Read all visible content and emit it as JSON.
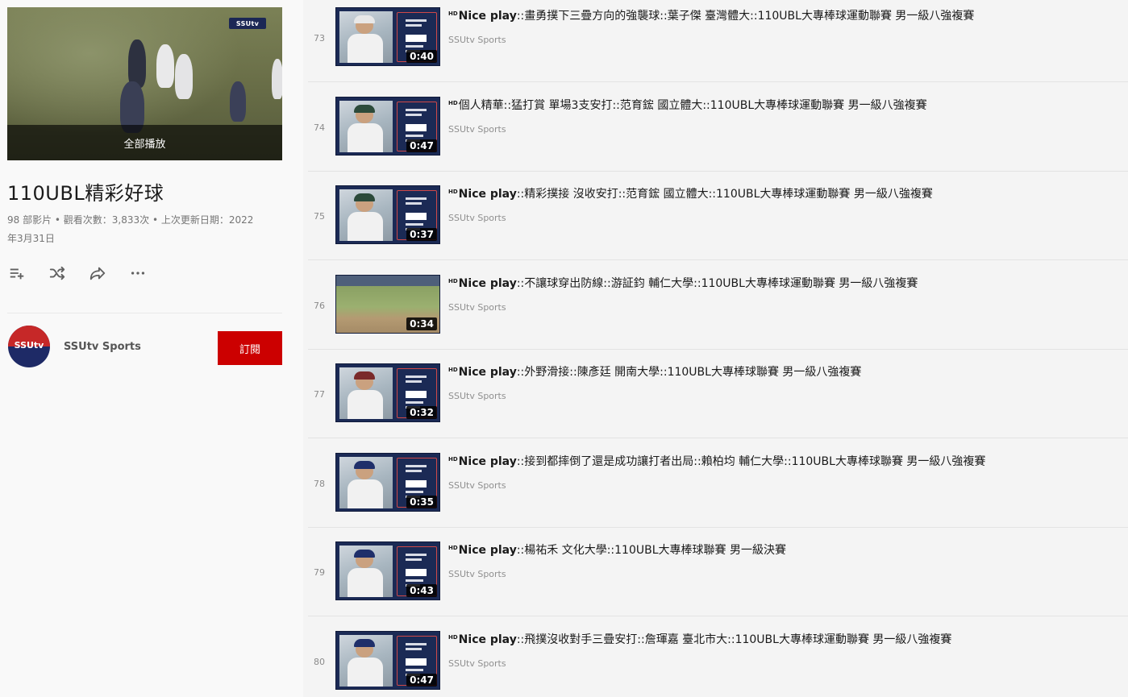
{
  "playlist": {
    "title": "110UBL精彩好球",
    "meta": "98 部影片 • 觀看次數：3,833次 • 上次更新日期：2022年3月31日",
    "play_all": "全部播放",
    "hero_logo": "SSUtv",
    "actions": [
      {
        "icon": "add-to-queue-icon"
      },
      {
        "icon": "shuffle-icon"
      },
      {
        "icon": "share-icon"
      },
      {
        "icon": "more-icon"
      }
    ]
  },
  "channel": {
    "name": "SSUtv Sports",
    "avatar_text": "SSUtv",
    "subscribe_label": "訂閱",
    "subscribe_color": "#cc0000"
  },
  "videos": [
    {
      "index": "73",
      "hd": "HD",
      "lead": "Nice play",
      "title": "::畫勇撲下三疊方向的強襲球::葉子傑 臺灣體大::110UBL大專棒球運動聯賽 男一級八強複賽",
      "channel": "SSUtv Sports",
      "duration": "0:40",
      "cap_color": "#e8e8e8"
    },
    {
      "index": "74",
      "hd": "HD",
      "lead": "",
      "title": "個人精華::猛打賞 單場3支安打::范育鋐 國立體大::110UBL大專棒球運動聯賽 男一級八強複賽",
      "channel": "SSUtv Sports",
      "duration": "0:47",
      "cap_color": "#2c4a3a"
    },
    {
      "index": "75",
      "hd": "HD",
      "lead": "Nice play",
      "title": "::精彩撲接 沒收安打::范育鋐 國立體大::110UBL大專棒球運動聯賽 男一級八強複賽",
      "channel": "SSUtv Sports",
      "duration": "0:37",
      "cap_color": "#2c4a3a"
    },
    {
      "index": "76",
      "hd": "HD",
      "lead": "Nice play",
      "title": "::不讓球穿出防線::游証鈞 輔仁大學::110UBL大專棒球運動聯賽 男一級八強複賽",
      "channel": "SSUtv Sports",
      "duration": "0:34",
      "cap_color": "#e8e8e8"
    },
    {
      "index": "77",
      "hd": "HD",
      "lead": "Nice play",
      "title": "::外野滑接::陳彥廷 開南大學::110UBL大專棒球聯賽 男一級八強複賽",
      "channel": "SSUtv Sports",
      "duration": "0:32",
      "cap_color": "#7a2a2a"
    },
    {
      "index": "78",
      "hd": "HD",
      "lead": "Nice play",
      "title": "::接到都摔倒了還是成功讓打者出局::賴柏均 輔仁大學::110UBL大專棒球聯賽 男一級八強複賽",
      "channel": "SSUtv Sports",
      "duration": "0:35",
      "cap_color": "#1f2f6a"
    },
    {
      "index": "79",
      "hd": "HD",
      "lead": "Nice play",
      "title": "::楊祐禾 文化大學::110UBL大專棒球聯賽 男一級決賽",
      "channel": "SSUtv Sports",
      "duration": "0:43",
      "cap_color": "#1f2f6a"
    },
    {
      "index": "80",
      "hd": "HD",
      "lead": "Nice play",
      "title": "::飛撲沒收對手三疊安打::詹琿嘉 臺北市大::110UBL大專棒球運動聯賽 男一級八強複賽",
      "channel": "SSUtv Sports",
      "duration": "0:47",
      "cap_color": "#1f2f6a"
    }
  ]
}
